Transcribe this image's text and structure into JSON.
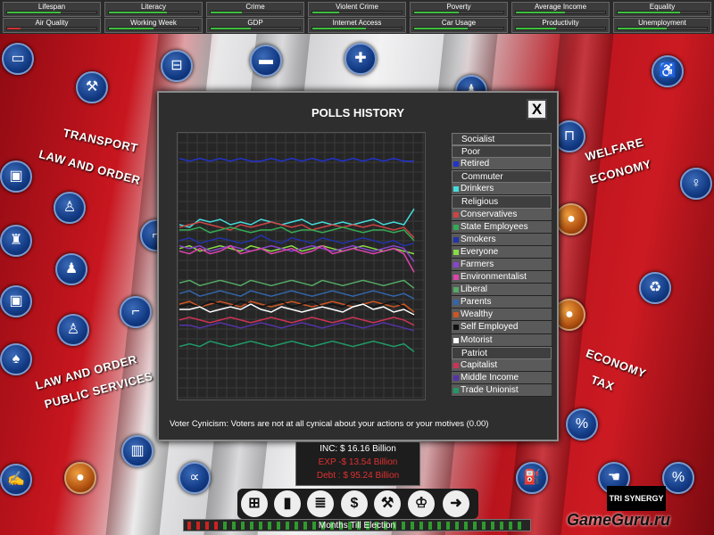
{
  "stats": [
    {
      "label": "Lifespan",
      "level": 0.6,
      "color": "green"
    },
    {
      "label": "Literacy",
      "level": 0.65,
      "color": "green"
    },
    {
      "label": "Crime",
      "level": 0.35,
      "color": "green"
    },
    {
      "label": "Violent Crime",
      "level": 0.3,
      "color": "green"
    },
    {
      "label": "Poverty",
      "level": 0.5,
      "color": "green"
    },
    {
      "label": "Average Income",
      "level": 0.55,
      "color": "green"
    },
    {
      "label": "Equality",
      "level": 0.7,
      "color": "green"
    },
    {
      "label": "Air Quality",
      "level": 0.15,
      "color": "red"
    },
    {
      "label": "Working Week",
      "level": 0.5,
      "color": "green"
    },
    {
      "label": "GDP",
      "level": 0.45,
      "color": "green"
    },
    {
      "label": "Internet Access",
      "level": 0.6,
      "color": "green"
    },
    {
      "label": "Car Usage",
      "level": 0.6,
      "color": "green"
    },
    {
      "label": "Productivity",
      "level": 0.45,
      "color": "green"
    },
    {
      "label": "Unemployment",
      "level": 0.55,
      "color": "green"
    }
  ],
  "categories": {
    "transport": "TRANSPORT",
    "law_order_1": "LAW AND ORDER",
    "law_order_2": "LAW AND ORDER",
    "public_services": "PUBLIC SERVICES",
    "welfare": "WELFARE",
    "economy_1": "ECONOMY",
    "economy_2": "ECONOMY",
    "tax": "TAX"
  },
  "modal": {
    "title": "POLLS HISTORY",
    "close_label": "X",
    "cynicism": "Voter Cynicism: Voters are not at all cynical about your actions or your motives (0.00)"
  },
  "legend": [
    {
      "label": "Socialist",
      "kind": "header"
    },
    {
      "label": "Poor",
      "kind": "header"
    },
    {
      "label": "Retired",
      "color": "#2233cc"
    },
    {
      "label": "Commuter",
      "kind": "header"
    },
    {
      "label": "Drinkers",
      "color": "#44dddd"
    },
    {
      "label": "Religious",
      "kind": "header"
    },
    {
      "label": "Conservatives",
      "color": "#cc4444"
    },
    {
      "label": "State Employees",
      "color": "#33aa55"
    },
    {
      "label": "Smokers",
      "color": "#2233aa"
    },
    {
      "label": "Everyone",
      "color": "#88dd44"
    },
    {
      "label": "Farmers",
      "color": "#8844cc"
    },
    {
      "label": "Environmentalist",
      "color": "#dd44aa"
    },
    {
      "label": "Liberal",
      "color": "#55aa66"
    },
    {
      "label": "Parents",
      "color": "#3366aa"
    },
    {
      "label": "Wealthy",
      "color": "#cc5522"
    },
    {
      "label": "Self Employed",
      "color": "#111111"
    },
    {
      "label": "Motorist",
      "color": "#ffffff"
    },
    {
      "label": "Patriot",
      "kind": "header"
    },
    {
      "label": "Capitalist",
      "color": "#cc3355"
    },
    {
      "label": "Middle Income",
      "color": "#5533aa"
    },
    {
      "label": "Trade Unionist",
      "color": "#229966"
    }
  ],
  "chart_data": {
    "type": "line",
    "title": "POLLS HISTORY",
    "grid": true,
    "ylim": [
      0,
      100
    ],
    "series": [
      {
        "name": "Retired",
        "color": "#2233cc",
        "values": [
          91,
          90,
          91,
          90,
          91,
          90,
          91,
          90,
          90,
          91,
          90,
          91,
          90,
          91,
          90,
          91,
          90,
          91,
          90,
          91,
          90,
          91,
          90,
          90
        ]
      },
      {
        "name": "Drinkers",
        "color": "#44dddd",
        "values": [
          66,
          65,
          68,
          67,
          68,
          66,
          67,
          66,
          68,
          67,
          66,
          67,
          68,
          66,
          67,
          66,
          67,
          66,
          67,
          68,
          66,
          67,
          66,
          72
        ]
      },
      {
        "name": "Conservatives",
        "color": "#cc4444",
        "values": [
          65,
          66,
          67,
          66,
          65,
          64,
          66,
          65,
          66,
          67,
          66,
          65,
          66,
          64,
          65,
          66,
          65,
          66,
          65,
          66,
          65,
          64,
          65,
          61
        ]
      },
      {
        "name": "State Employees",
        "color": "#33aa55",
        "values": [
          64,
          64,
          65,
          63,
          64,
          65,
          64,
          63,
          64,
          64,
          65,
          63,
          64,
          64,
          63,
          64,
          65,
          64,
          63,
          64,
          64,
          63,
          64,
          60
        ]
      },
      {
        "name": "Smokers",
        "color": "#2233aa",
        "values": [
          60,
          61,
          59,
          60,
          61,
          60,
          59,
          60,
          62,
          60,
          59,
          61,
          60,
          59,
          61,
          60,
          59,
          60,
          61,
          60,
          59,
          60,
          58,
          59
        ]
      },
      {
        "name": "Everyone",
        "color": "#88dd44",
        "values": [
          57,
          58,
          56,
          57,
          58,
          57,
          56,
          58,
          57,
          56,
          57,
          58,
          56,
          57,
          58,
          57,
          56,
          57,
          58,
          57,
          56,
          57,
          56,
          55
        ]
      },
      {
        "name": "Farmers",
        "color": "#8844cc",
        "values": [
          58,
          57,
          58,
          56,
          57,
          58,
          57,
          56,
          57,
          58,
          57,
          56,
          57,
          58,
          57,
          56,
          57,
          58,
          57,
          56,
          57,
          58,
          57,
          52
        ]
      },
      {
        "name": "Environmentalist",
        "color": "#dd44aa",
        "values": [
          56,
          55,
          57,
          55,
          56,
          58,
          55,
          56,
          57,
          55,
          56,
          57,
          55,
          56,
          58,
          55,
          56,
          57,
          56,
          55,
          56,
          57,
          55,
          48
        ]
      },
      {
        "name": "Liberal",
        "color": "#55aa66",
        "values": [
          44,
          45,
          43,
          44,
          45,
          44,
          43,
          45,
          44,
          43,
          44,
          45,
          44,
          43,
          45,
          44,
          43,
          44,
          45,
          44,
          43,
          44,
          45,
          42
        ]
      },
      {
        "name": "Parents",
        "color": "#3366aa",
        "values": [
          40,
          41,
          39,
          40,
          41,
          40,
          39,
          41,
          40,
          39,
          40,
          41,
          40,
          39,
          40,
          41,
          40,
          39,
          40,
          41,
          40,
          39,
          40,
          38
        ]
      },
      {
        "name": "Wealthy",
        "color": "#cc5522",
        "values": [
          36,
          37,
          35,
          36,
          37,
          36,
          35,
          37,
          36,
          35,
          36,
          37,
          36,
          35,
          36,
          37,
          36,
          35,
          36,
          37,
          36,
          35,
          36,
          33
        ]
      },
      {
        "name": "Self Employed",
        "color": "#111111",
        "values": [
          35,
          36,
          35,
          37,
          36,
          35,
          37,
          36,
          35,
          36,
          37,
          35,
          36,
          37,
          35,
          36,
          35,
          37,
          36,
          35,
          36,
          37,
          35,
          31
        ]
      },
      {
        "name": "Motorist",
        "color": "#ffffff",
        "values": [
          34,
          34,
          35,
          33,
          34,
          35,
          34,
          36,
          34,
          33,
          35,
          34,
          33,
          34,
          35,
          34,
          33,
          35,
          36,
          34,
          35,
          33,
          34,
          32
        ]
      },
      {
        "name": "Capitalist",
        "color": "#cc3355",
        "values": [
          30,
          31,
          30,
          29,
          30,
          31,
          30,
          29,
          30,
          31,
          30,
          29,
          30,
          31,
          30,
          29,
          30,
          31,
          30,
          29,
          30,
          31,
          30,
          28
        ]
      },
      {
        "name": "Middle Income",
        "color": "#5533aa",
        "values": [
          28,
          28,
          27,
          28,
          29,
          28,
          27,
          28,
          29,
          28,
          27,
          28,
          29,
          28,
          27,
          28,
          29,
          28,
          27,
          28,
          29,
          28,
          27,
          26
        ]
      },
      {
        "name": "Trade Unionist",
        "color": "#229966",
        "values": [
          20,
          21,
          20,
          22,
          21,
          20,
          21,
          22,
          21,
          20,
          21,
          22,
          21,
          20,
          21,
          22,
          21,
          20,
          21,
          22,
          21,
          20,
          21,
          18
        ]
      }
    ]
  },
  "finance": {
    "inc": "INC: $ 16.16 Billion",
    "exp": "EXP -$ 13.54 Billion",
    "debt": "Debt : $ 95.24 Billion"
  },
  "toolbar": {
    "months_label": "Months Till Election"
  },
  "logo": "TRI SYNERGY",
  "watermark": "GameGuru.ru"
}
